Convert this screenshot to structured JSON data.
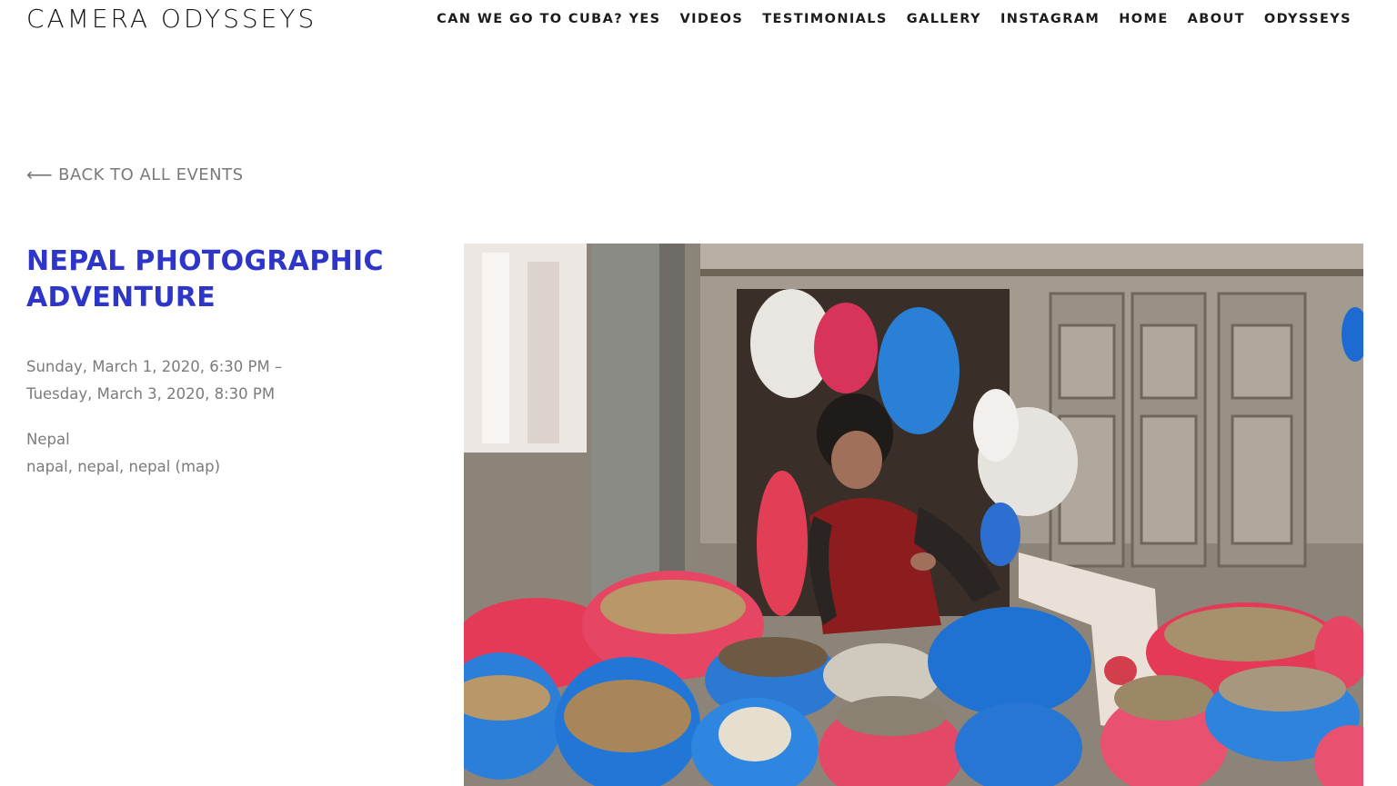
{
  "site": {
    "title": "CAMERA ODYSSEYS"
  },
  "nav": {
    "items": [
      {
        "label": "CAN WE GO TO CUBA? YES",
        "name": "nav-cuba"
      },
      {
        "label": "VIDEOS",
        "name": "nav-videos"
      },
      {
        "label": "TESTIMONIALS",
        "name": "nav-testimonials"
      },
      {
        "label": "GALLERY",
        "name": "nav-gallery"
      },
      {
        "label": "INSTAGRAM",
        "name": "nav-instagram"
      },
      {
        "label": "HOME",
        "name": "nav-home"
      },
      {
        "label": "ABOUT",
        "name": "nav-about"
      },
      {
        "label": "ODYSSEYS",
        "name": "nav-odysseys"
      }
    ]
  },
  "event": {
    "back_arrow": "⟵",
    "back_label": "BACK TO ALL EVENTS",
    "title": "NEPAL PHOTOGRAPHIC ADVENTURE",
    "date_start": "Sunday, March 1, 2020, 6:30 PM –",
    "date_end": "Tuesday, March 3, 2020, 8:30 PM",
    "location_name": "Nepal",
    "address": "napal, nepal, nepal",
    "map_link": "(map)",
    "accent_color": "#2e36c9"
  }
}
